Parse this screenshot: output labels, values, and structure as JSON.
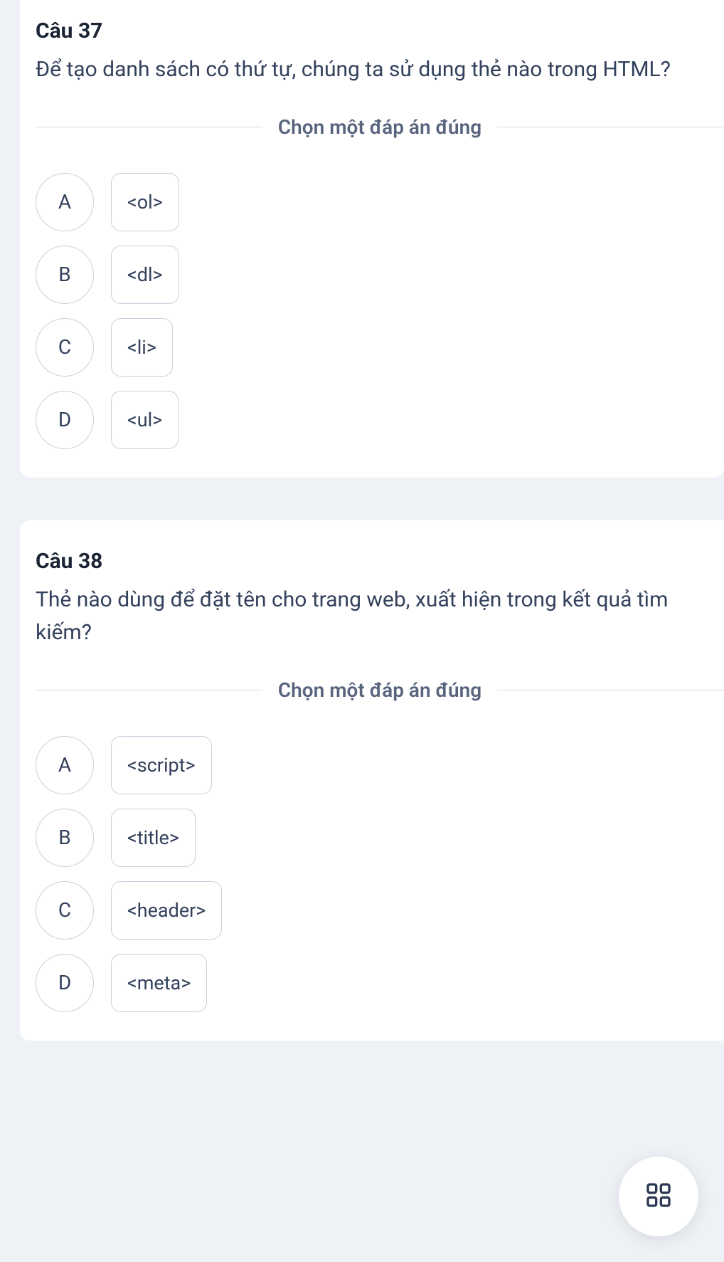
{
  "questions": [
    {
      "title": "Câu 37",
      "text": "Để tạo danh sách có thứ tự, chúng ta sử dụng thẻ nào trong HTML?",
      "instruction": "Chọn một đáp án đúng",
      "options": [
        {
          "letter": "A",
          "label": "<ol>"
        },
        {
          "letter": "B",
          "label": "<dl>"
        },
        {
          "letter": "C",
          "label": "<li>"
        },
        {
          "letter": "D",
          "label": "<ul>"
        }
      ]
    },
    {
      "title": "Câu 38",
      "text": "Thẻ nào dùng để đặt tên cho trang web, xuất hiện trong kết quả tìm kiếm?",
      "instruction": "Chọn một đáp án đúng",
      "options": [
        {
          "letter": "A",
          "label": "<script>"
        },
        {
          "letter": "B",
          "label": "<title>"
        },
        {
          "letter": "C",
          "label": "<header>"
        },
        {
          "letter": "D",
          "label": "<meta>"
        }
      ]
    }
  ]
}
